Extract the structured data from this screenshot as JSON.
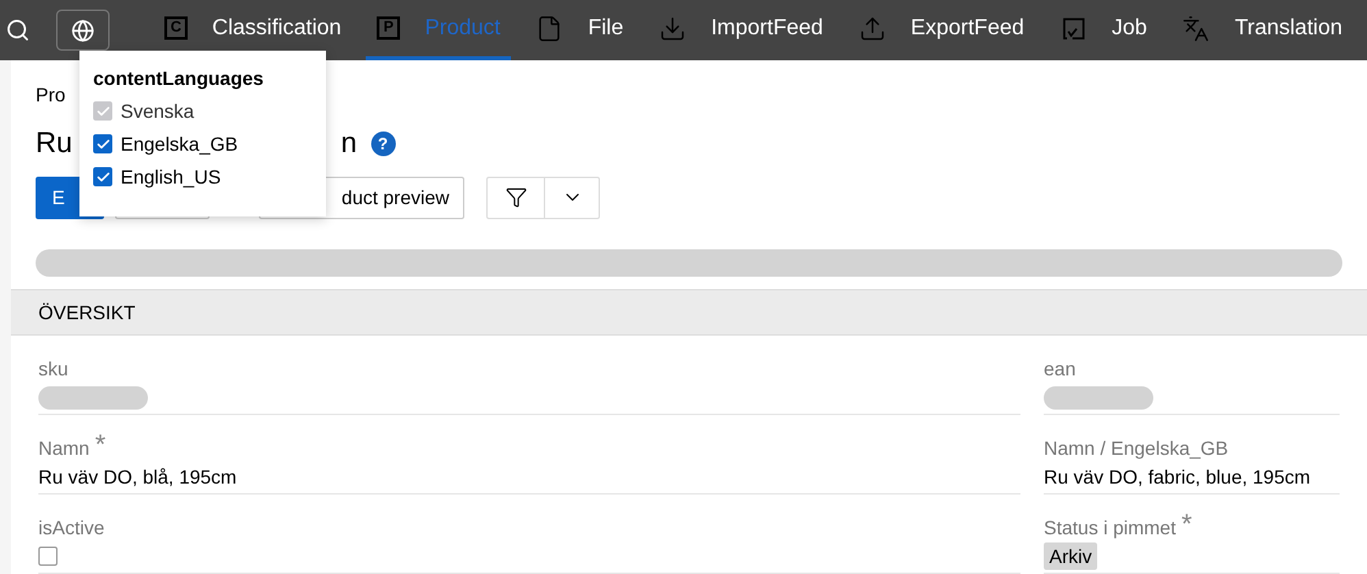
{
  "nav": {
    "items": [
      {
        "label": "Classification",
        "kind": "letter",
        "badge": "C",
        "selected": false
      },
      {
        "label": "Product",
        "kind": "letter",
        "badge": "P",
        "selected": true
      },
      {
        "label": "File",
        "kind": "file",
        "selected": false
      },
      {
        "label": "ImportFeed",
        "kind": "download",
        "selected": false
      },
      {
        "label": "ExportFeed",
        "kind": "upload",
        "selected": false
      },
      {
        "label": "Job",
        "kind": "job",
        "selected": false
      },
      {
        "label": "Translation",
        "kind": "translate",
        "selected": false
      }
    ]
  },
  "language_menu": {
    "title": "contentLanguages",
    "options": [
      {
        "label": "Svenska",
        "checked": true,
        "disabled": true
      },
      {
        "label": "Engelska_GB",
        "checked": true,
        "disabled": false
      },
      {
        "label": "English_US",
        "checked": true,
        "disabled": false
      }
    ]
  },
  "breadcrumb": "Pro",
  "title": {
    "start": "Ru",
    "end": "n",
    "help": "?"
  },
  "toolbar": {
    "primary_button": "E",
    "preview_button": "duct preview"
  },
  "section": {
    "title": "ÖVERSIKT"
  },
  "fields_left": [
    {
      "label": "sku",
      "kind": "redacted"
    },
    {
      "label": "Namn",
      "kind": "text",
      "marker": "*",
      "value": "Ru väv DO, blå, 195cm"
    },
    {
      "label": "isActive",
      "kind": "checkbox",
      "checked": false
    }
  ],
  "fields_right": [
    {
      "label": "ean",
      "kind": "redacted"
    },
    {
      "label": "Namn / Engelska_GB",
      "kind": "text",
      "value": "Ru väv DO, fabric, blue, 195cm"
    },
    {
      "label": "Status i pimmet",
      "kind": "tag",
      "marker": "*",
      "value": "Arkiv"
    }
  ]
}
